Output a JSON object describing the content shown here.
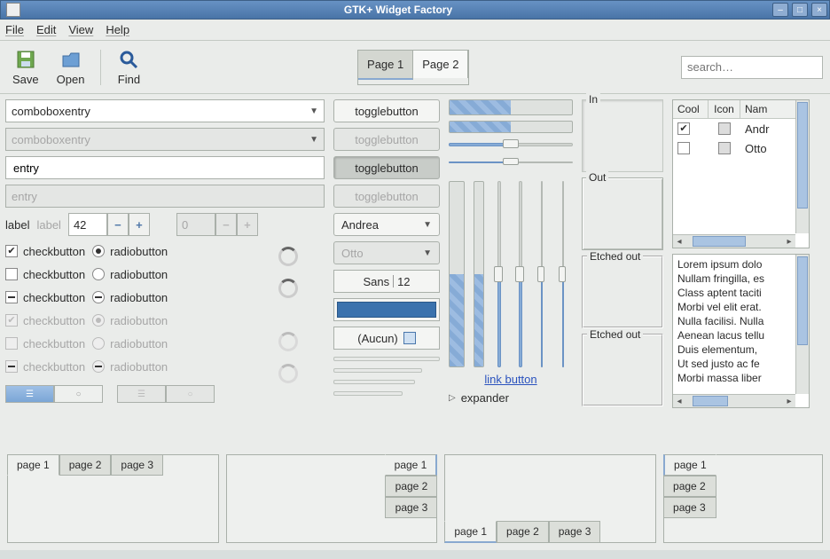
{
  "window": {
    "title": "GTK+ Widget Factory"
  },
  "titlebar_icons": {
    "min": "–",
    "max": "□",
    "close": "×"
  },
  "menu": {
    "file": "File",
    "edit": "Edit",
    "view": "View",
    "help": "Help"
  },
  "toolbar": {
    "save": "Save",
    "open": "Open",
    "find": "Find",
    "page1": "Page 1",
    "page2": "Page 2",
    "search_placeholder": "search…"
  },
  "col1": {
    "combo1": "comboboxentry",
    "combo2_placeholder": "comboboxentry",
    "entry1": "entry",
    "entry2_placeholder": "entry",
    "label": "label",
    "label_dis": "label",
    "spin_value": "42",
    "spin_dis_value": "0",
    "check": "checkbutton",
    "radio": "radiobutton"
  },
  "col2": {
    "toggle": "togglebutton",
    "dropdown1": "Andrea",
    "dropdown2": "Otto",
    "font_family": "Sans",
    "font_size": "12",
    "file_none": "(Aucun)"
  },
  "col3": {
    "link": "link button",
    "expander": "expander",
    "hprog1_pct": 50,
    "hprog2_pct": 50,
    "hscale1_pct": 50,
    "hscale2_pct": 50,
    "vprog1_pct": 50,
    "vprog2_pct": 50,
    "vscale1_pct": 50,
    "vscale2_pct": 50,
    "vscale3_pct": 50,
    "vscale4_pct": 50
  },
  "col4": {
    "in": "In",
    "out": "Out",
    "etched_out1": "Etched out",
    "etched_out2": "Etched out"
  },
  "col5": {
    "columns": {
      "cool": "Cool",
      "icon": "Icon",
      "name": "Nam"
    },
    "rows": [
      {
        "cool": true,
        "name": "Andr"
      },
      {
        "cool": false,
        "name": "Otto"
      }
    ],
    "lorem": "Lorem ipsum dolo\nNullam fringilla, es\nClass aptent taciti\nMorbi vel elit erat.\nNulla facilisi. Nulla\nAenean lacus tellu\nDuis elementum,\nUt sed justo ac fe\nMorbi massa liber"
  },
  "bottom": {
    "p1": "page 1",
    "p2": "page 2",
    "p3": "page 3"
  }
}
